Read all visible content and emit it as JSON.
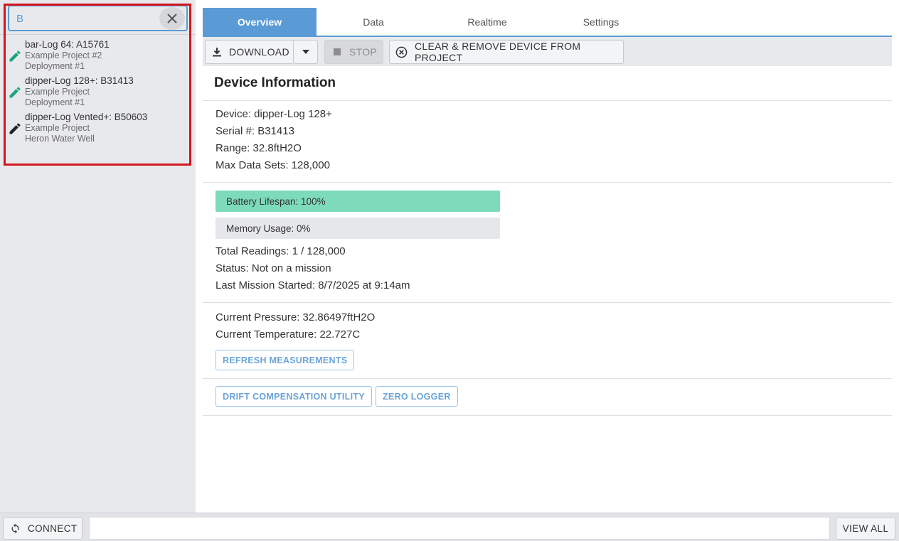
{
  "search": {
    "value": "B",
    "clear_icon": "close-icon"
  },
  "devices": [
    {
      "name": "bar-Log 64: A15761",
      "project": "Example Project #2",
      "location": "Deployment #1",
      "icon": "pencil-icon",
      "icon_color": "#1aa37a"
    },
    {
      "name": "dipper-Log 128+: B31413",
      "project": "Example Project",
      "location": "Deployment #1",
      "icon": "pencil-icon",
      "icon_color": "#1aa37a"
    },
    {
      "name": "dipper-Log Vented+: B50603",
      "project": "Example Project",
      "location": "Heron Water Well",
      "icon": "pencil-icon",
      "icon_color": "#222222"
    }
  ],
  "tabs": [
    {
      "label": "Overview",
      "active": true
    },
    {
      "label": "Data",
      "active": false
    },
    {
      "label": "Realtime",
      "active": false
    },
    {
      "label": "Settings",
      "active": false
    }
  ],
  "toolbar": {
    "download_label": "DOWNLOAD",
    "stop_label": "STOP",
    "clear_label": "CLEAR & REMOVE DEVICE FROM PROJECT"
  },
  "device_info": {
    "title": "Device Information",
    "device": "Device: dipper-Log 128+",
    "serial": "Serial #: B31413",
    "range": "Range: 32.8ftH2O",
    "max_data_sets": "Max Data Sets: 128,000"
  },
  "status": {
    "battery_label": "Battery Lifespan: 100%",
    "battery_fraction": 1.0,
    "memory_label": "Memory Usage: 0%",
    "memory_fraction": 0.0,
    "total_readings": "Total Readings: 1 / 128,000",
    "status_text": "Status: Not on a mission",
    "last_mission": "Last Mission Started: 8/7/2025 at 9:14am"
  },
  "measurements": {
    "pressure": "Current Pressure: 32.86497ftH2O",
    "temperature": "Current Temperature: 22.727C",
    "refresh_label": "REFRESH MEASUREMENTS"
  },
  "utilities": {
    "drift_label": "DRIFT COMPENSATION UTILITY",
    "zero_label": "ZERO LOGGER"
  },
  "bottom": {
    "connect_label": "CONNECT",
    "view_all_label": "VIEW ALL"
  },
  "colors": {
    "accent": "#5b9bd5",
    "battery_fill": "#7ddbbb",
    "highlight": "#d0161e"
  }
}
